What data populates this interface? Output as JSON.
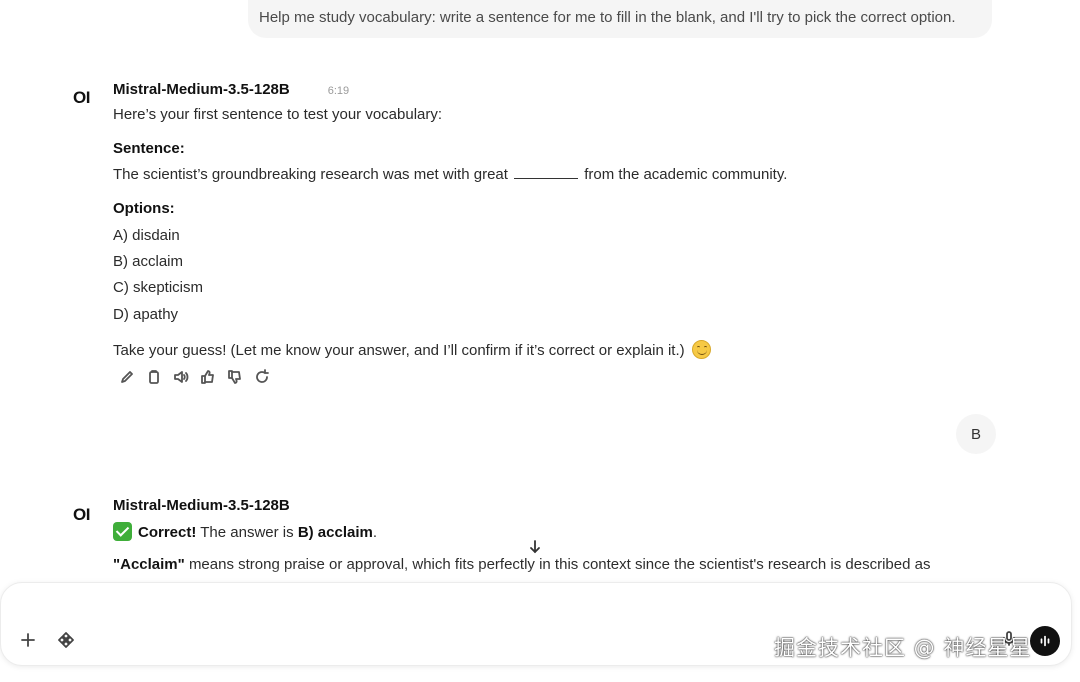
{
  "user_messages": [
    {
      "text": "Help me study vocabulary: write a sentence for me to fill in the blank, and I'll try to pick the correct option."
    },
    {
      "text": "B"
    }
  ],
  "assistant_messages": [
    {
      "avatar": "OI",
      "model": "Mistral-Medium-3.5-128B",
      "time": "6:19",
      "intro": "Here’s your first sentence to test your vocabulary:",
      "sentence_heading": "Sentence:",
      "sentence_before": "The scientist’s groundbreaking research was met with great",
      "sentence_after": "from the academic community.",
      "options_heading": "Options:",
      "options": [
        "A) disdain",
        "B) acclaim",
        "C) skepticism",
        "D) apathy"
      ],
      "closing": "Take your guess! (Let me know your answer, and I’ll confirm if it’s correct or explain it.)",
      "actions": [
        "edit-icon",
        "copy-icon",
        "speaker-icon",
        "thumbs-up-icon",
        "thumbs-down-icon",
        "regenerate-icon"
      ]
    },
    {
      "avatar": "OI",
      "model": "Mistral-Medium-3.5-128B",
      "correct_label": "Correct!",
      "answer_prefix": "The answer is",
      "answer_value": "B) acclaim",
      "answer_suffix": ".",
      "explain_term": "\"Acclaim\"",
      "explain_text": "means strong praise or approval, which fits perfectly in this context since the scientist's research is described as"
    }
  ],
  "composer": {
    "placeholder": "",
    "plus_icon": "plus-icon",
    "integrations_icon": "integrations-icon"
  },
  "watermark": "掘金技术社区 @ 神经星星"
}
